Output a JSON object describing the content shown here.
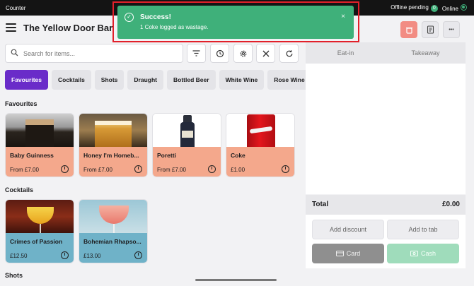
{
  "status": {
    "left": "Counter",
    "offline": "Offline pending",
    "offline_count": "0",
    "online": "Online"
  },
  "header": {
    "title": "The Yellow Door Bar"
  },
  "toast": {
    "title": "Success!",
    "message": "1 Coke  logged as wastage.",
    "close": "×"
  },
  "search": {
    "placeholder": "Search for items..."
  },
  "categories": [
    "Favourites",
    "Cocktails",
    "Shots",
    "Draught",
    "Bottled Beer",
    "White Wine",
    "Rose Wine"
  ],
  "sections": {
    "favourites": "Favourites",
    "cocktails": "Cocktails",
    "shots": "Shots"
  },
  "favourites": [
    {
      "name": "Baby Guinness",
      "price": "From £7.00"
    },
    {
      "name": "Honey I'm Homeb...",
      "price": "From £7.00"
    },
    {
      "name": "Poretti",
      "price": "From £7.00"
    },
    {
      "name": "Coke",
      "price": "£1.00"
    }
  ],
  "cocktails": [
    {
      "name": "Crimes of Passion",
      "price": "£12.50"
    },
    {
      "name": "Bohemian Rhapso...",
      "price": "£13.00"
    }
  ],
  "order": {
    "tabs": [
      "Eat-in",
      "Takeaway"
    ],
    "total_label": "Total",
    "total": "£0.00",
    "add_discount": "Add discount",
    "add_to_tab": "Add to tab",
    "card": "Card",
    "cash": "Cash"
  },
  "icons": {
    "info": "i",
    "more": "•••"
  }
}
